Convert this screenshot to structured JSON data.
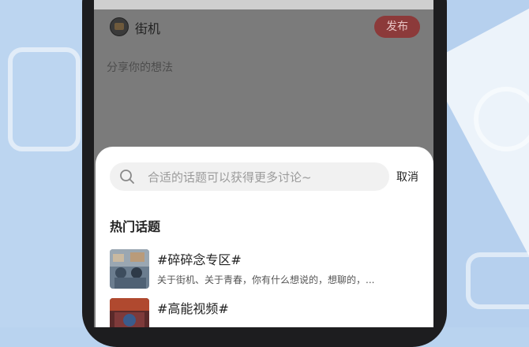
{
  "composer": {
    "section_name": "街机",
    "publish_label": "发布",
    "share_placeholder": "分享你的想法"
  },
  "topic_sheet": {
    "search_placeholder": "合适的话题可以获得更多讨论~",
    "cancel_label": "取消",
    "hot_topics_title": "热门话题",
    "topics": [
      {
        "name": "#碎碎念专区#",
        "description": "关于街机、关于青春，你有什么想说的，想聊的，..."
      },
      {
        "name": "#高能视频#",
        "description": ""
      }
    ]
  },
  "colors": {
    "publish_button": "#8c3a3a",
    "background_blue": "#b9d3ef",
    "sheet_background": "#ffffff"
  }
}
